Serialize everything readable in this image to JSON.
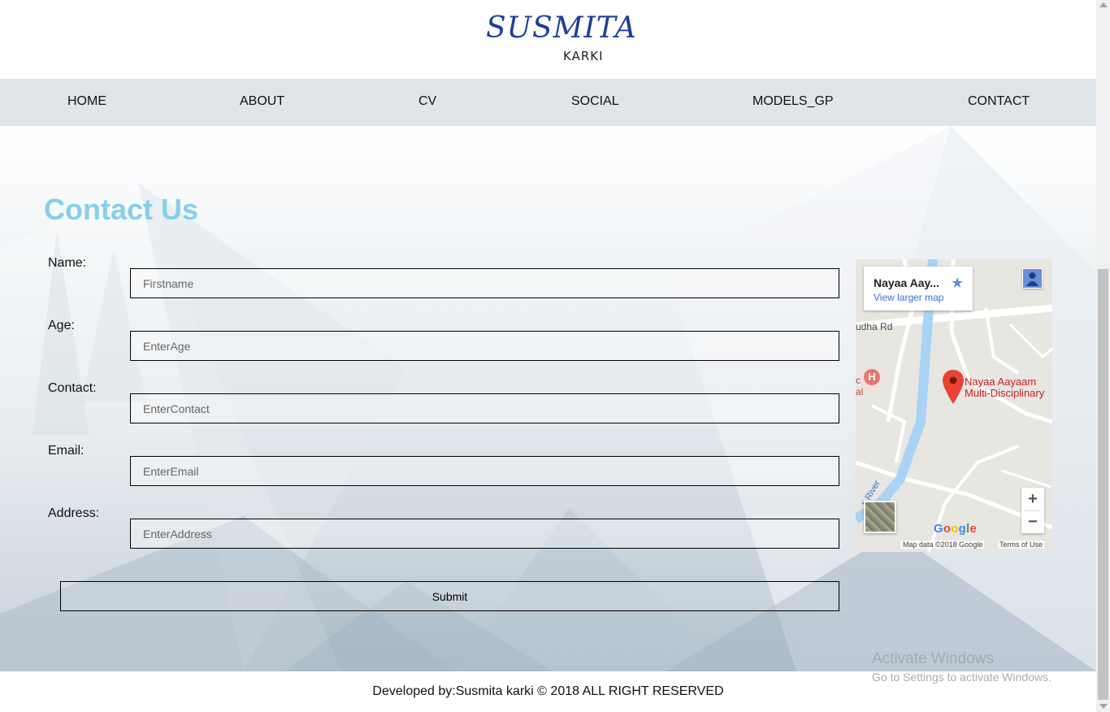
{
  "header": {
    "logo_main": "SUSMITA",
    "logo_sub": "KARKI"
  },
  "nav": {
    "items": [
      {
        "label": "HOME"
      },
      {
        "label": "ABOUT"
      },
      {
        "label": "CV"
      },
      {
        "label": "SOCIAL"
      },
      {
        "label": "MODELS_GP"
      },
      {
        "label": "CONTACT"
      }
    ]
  },
  "contact": {
    "title": "Contact Us",
    "fields": [
      {
        "label": "Name:",
        "placeholder": "Firstname",
        "value": ""
      },
      {
        "label": "Age:",
        "placeholder": "EnterAge",
        "value": ""
      },
      {
        "label": "Contact:",
        "placeholder": "EnterContact",
        "value": ""
      },
      {
        "label": "Email:",
        "placeholder": "EnterEmail",
        "value": ""
      },
      {
        "label": "Address:",
        "placeholder": "EnterAddress",
        "value": ""
      }
    ],
    "submit_label": "Submit"
  },
  "map": {
    "place_short": "Nayaa Aay...",
    "view_larger": "View larger map",
    "road_label": "udha Rd",
    "hospital_label": "c\nal",
    "place_label": "Nayaa Aayaam\nMulti-Disciplinary",
    "river_label": "ti River",
    "zoom_in": "+",
    "zoom_out": "−",
    "google": "Google",
    "attribution": "Map data ©2018 Google",
    "terms": "Terms of Use",
    "accent_color": "#5b8ee6"
  },
  "footer": {
    "text": "Developed by:Susmita karki © 2018 ALL RIGHT RESERVED"
  },
  "overlay": {
    "activate_title": "Activate Windows",
    "activate_sub": "Go to Settings to activate Windows."
  },
  "colors": {
    "title": "#87ceeb",
    "nav_bg": "#e0e5e9",
    "logo": "#1d3f9c"
  }
}
